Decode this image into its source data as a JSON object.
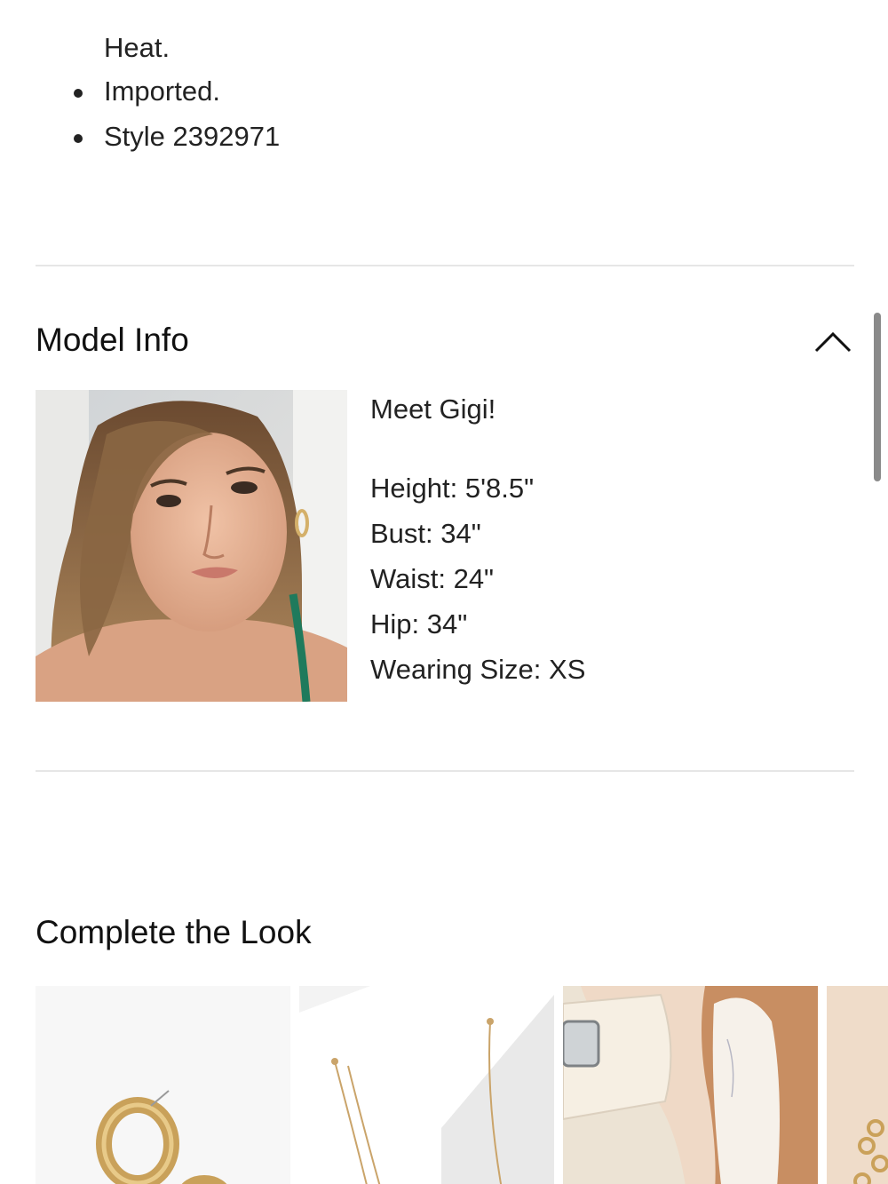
{
  "details": {
    "continued_text": "Heat.",
    "bullets": [
      "Imported.",
      "Style 2392971"
    ]
  },
  "model_info": {
    "title": "Model Info",
    "toggle_icon": "chevron-up-icon",
    "greeting": "Meet Gigi!",
    "stats": [
      "Height: 5'8.5\"",
      "Bust: 34\"",
      "Waist: 24\"",
      "Hip: 34\"",
      "Wearing Size: XS"
    ]
  },
  "complete_the_look": {
    "title": "Complete the Look",
    "items": [
      {
        "icon": "gold-hoop-earrings"
      },
      {
        "icon": "layered-gold-necklace"
      },
      {
        "icon": "cream-sandal"
      },
      {
        "icon": "gold-chain-jewelry"
      }
    ]
  },
  "colors": {
    "text": "#222222",
    "divider": "#e6e6e6",
    "scrollbar": "#8a8a8a"
  }
}
